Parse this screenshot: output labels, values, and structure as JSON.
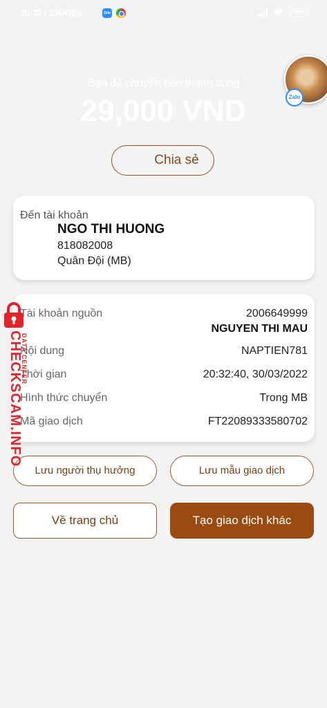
{
  "status_bar": {
    "time_text": "20:32 | 196KB/s",
    "battery": "100"
  },
  "result": {
    "success_message": "Bạn đã chuyển tiền thành công",
    "amount": "29,000 VND"
  },
  "zalo": {
    "badge_label": "Zalo"
  },
  "share_button": "Chia sẻ",
  "destination": {
    "label": "Đến tài khoản",
    "name": "NGO THI HUONG",
    "account_number": "818082008",
    "bank": "Quân Đội (MB)"
  },
  "details": {
    "source_label": "Tài khoản nguồn",
    "source_account": "2006649999",
    "source_name": "NGUYEN THI MAU",
    "content_label": "Nội dung",
    "content_value": "NAPTIEN781",
    "time_label": "Thời gian",
    "time_value": "20:32:40, 30/03/2022",
    "method_label": "Hình thức chuyển",
    "method_value": "Trong MB",
    "ref_label": "Mã giao dịch",
    "ref_value": "FT22089333580702"
  },
  "actions": {
    "save_recipient": "Lưu người thụ hưởng",
    "save_template": "Lưu mẫu giao dịch",
    "home": "Về trang chủ",
    "new_transaction": "Tạo giao dịch khác"
  },
  "watermark": {
    "main": "CHECKSCAM.INFO",
    "sub": "DATA CENTER"
  },
  "colors": {
    "accent": "#9b4a10",
    "watermark": "#e0242a",
    "background": "#f3f3f3"
  },
  "icons": [
    "zalo-icon",
    "chrome-icon",
    "signal-icon",
    "wifi-icon",
    "battery-icon",
    "lock-icon"
  ]
}
